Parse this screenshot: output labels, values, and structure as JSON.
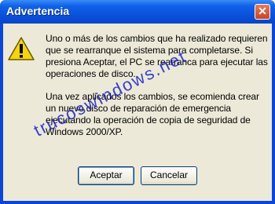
{
  "window": {
    "title": "Advertencia",
    "close_glyph": "✕"
  },
  "icon": {
    "name": "warning-icon",
    "glyph": "!"
  },
  "message": {
    "paragraph1": "Uno o más de los cambios que ha realizado requieren que se rearranque el sistema para completarse. Si presiona Aceptar, el PC se rearranca para ejecutar las operaciones de disco.",
    "paragraph2": "Una vez aplicados los cambios, se ecomienda crear un nuevo disco de reparación de emergencia ejecutando la operación de copia de seguridad de Windows 2000/XP."
  },
  "buttons": {
    "accept_label": "Aceptar",
    "cancel_label": "Cancelar"
  },
  "watermark": "trucoswindows.net",
  "colors": {
    "titlebar": "#0a4fd8",
    "client_bg": "#ece9d8",
    "warning_yellow": "#f5d311",
    "close_red": "#c94525",
    "watermark": "#1a22c8"
  }
}
